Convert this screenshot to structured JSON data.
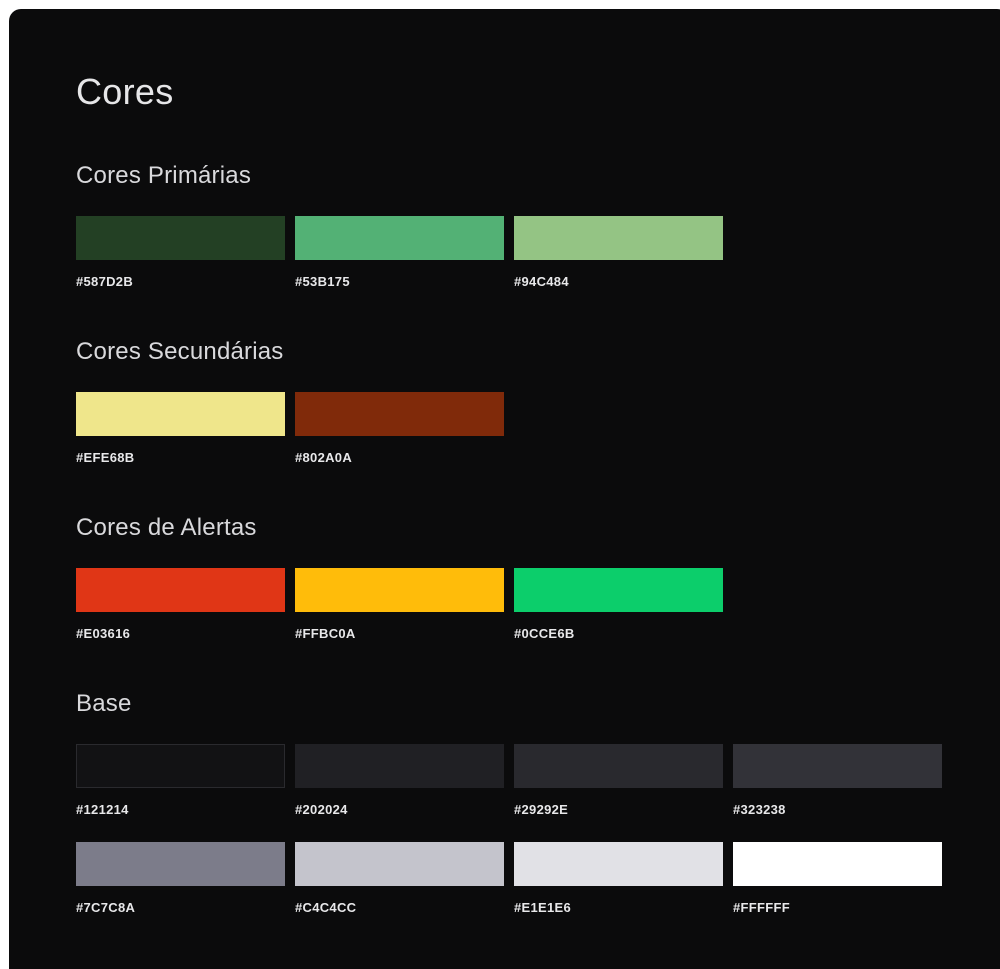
{
  "title": "Cores",
  "sections": {
    "primary": {
      "title": "Cores Primárias",
      "swatches": [
        {
          "code": "#587D2B",
          "color": "#234024"
        },
        {
          "code": "#53B175",
          "color": "#53B175"
        },
        {
          "code": "#94C484",
          "color": "#94C484"
        }
      ]
    },
    "secondary": {
      "title": "Cores Secundárias",
      "swatches": [
        {
          "code": "#EFE68B",
          "color": "#EFE68B"
        },
        {
          "code": "#802A0A",
          "color": "#802A0A"
        }
      ]
    },
    "alerts": {
      "title": "Cores de Alertas",
      "swatches": [
        {
          "code": "#E03616",
          "color": "#E03616"
        },
        {
          "code": "#FFBC0A",
          "color": "#FFBC0A"
        },
        {
          "code": "#0CCE6B",
          "color": "#0CCE6B"
        }
      ]
    },
    "base": {
      "title": "Base",
      "swatches": [
        {
          "code": "#121214",
          "color": "#121214"
        },
        {
          "code": "#202024",
          "color": "#202024"
        },
        {
          "code": "#29292E",
          "color": "#29292E"
        },
        {
          "code": "#323238",
          "color": "#323238"
        },
        {
          "code": "#7C7C8A",
          "color": "#7C7C8A"
        },
        {
          "code": "#C4C4CC",
          "color": "#C4C4CC"
        },
        {
          "code": "#E1E1E6",
          "color": "#E1E1E6"
        },
        {
          "code": "#FFFFFF",
          "color": "#FFFFFF"
        }
      ]
    }
  }
}
